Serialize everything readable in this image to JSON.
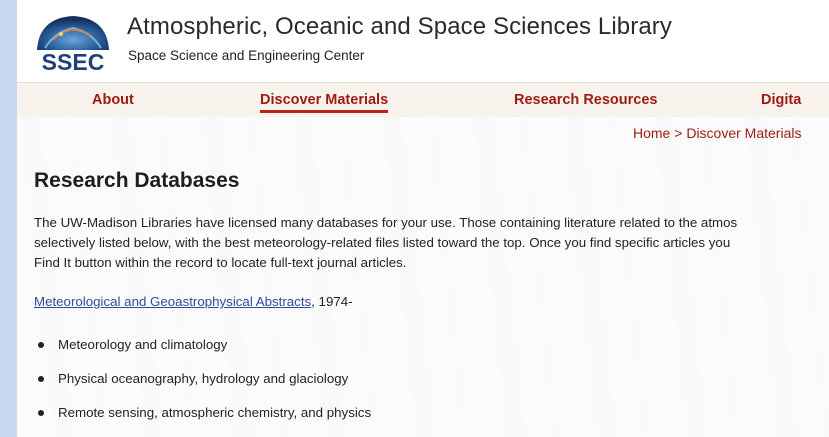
{
  "header": {
    "logo_text": "SSEC",
    "title": "Atmospheric, Oceanic and Space Sciences Library",
    "subtitle": "Space Science and Engineering Center"
  },
  "nav": {
    "items": [
      {
        "label": "About",
        "active": false
      },
      {
        "label": "Discover Materials",
        "active": true
      },
      {
        "label": "Research Resources",
        "active": false
      },
      {
        "label": "Digita",
        "active": false
      }
    ]
  },
  "breadcrumb": {
    "home": "Home",
    "separator": ">",
    "current": "Discover Materials"
  },
  "main": {
    "title": "Research Databases",
    "intro_lines": [
      "The UW-Madison Libraries have licensed many databases for your use. Those containing literature related to the atmos",
      "selectively listed below, with the best meteorology-related files listed toward the top. Once you find specific articles you",
      "Find It button within the record to locate full-text journal articles."
    ],
    "database": {
      "link_text": "Meteorological and Geoastrophysical Abstracts",
      "suffix": ", 1974-"
    },
    "bullets": [
      "Meteorology and climatology",
      "Physical oceanography, hydrology and glaciology",
      "Remote sensing, atmospheric chemistry, and physics"
    ]
  },
  "colors": {
    "nav_text": "#9c1c14",
    "link": "#2a4d9c",
    "outer_background": "#c6d9ef"
  }
}
